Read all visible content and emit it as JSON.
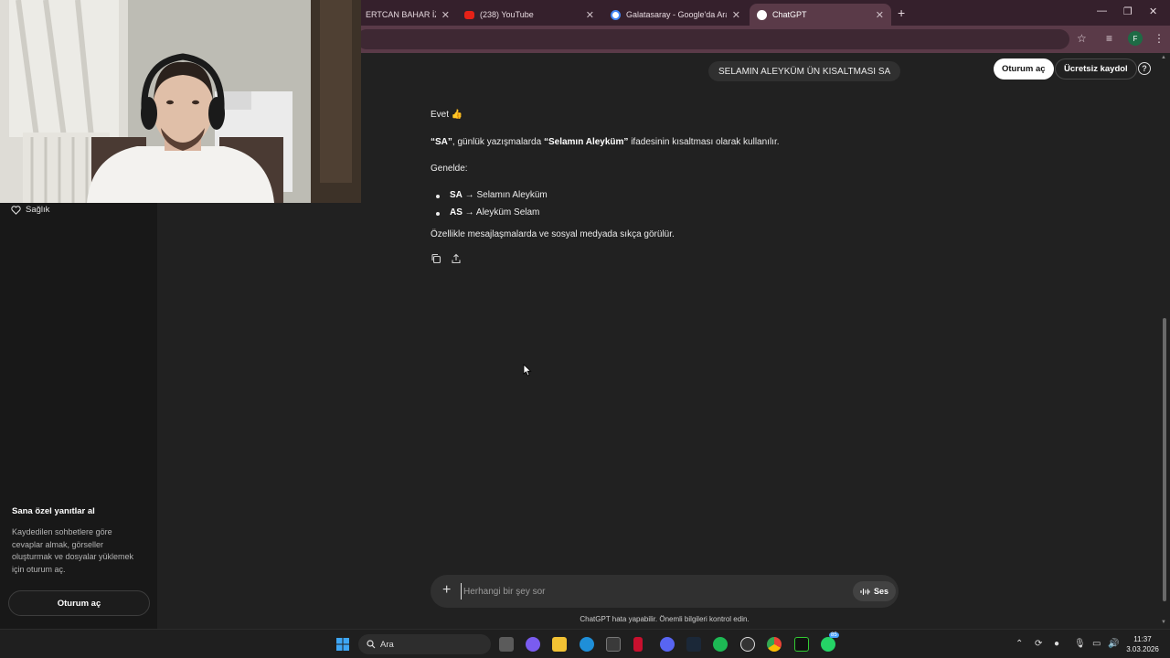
{
  "browser": {
    "tabs": [
      {
        "title": "ERTCAN BAHAR İZLİYOR",
        "active": false
      },
      {
        "title": "(238) YouTube",
        "active": false
      },
      {
        "title": "Galatasaray - Google'da Ara",
        "active": false
      },
      {
        "title": "ChatGPT",
        "active": true
      }
    ],
    "new_tab": "+",
    "profile_initial": "F"
  },
  "sidebar": {
    "health_label": "Sağlık",
    "promo_title": "Sana özel yanıtlar al",
    "promo_text": "Kaydedilen sohbetlere göre cevaplar almak, görseller oluşturmak ve dosyalar yüklemek için oturum aç.",
    "login_label": "Oturum aç"
  },
  "header": {
    "login_label": "Oturum aç",
    "signup_label": "Ücretsiz kaydol",
    "help": "?"
  },
  "chat": {
    "user_message": "SELAMIN ALEYKÜM ÜN KISALTMASI SA",
    "answer": {
      "intro": "Evet 👍",
      "p1_term": "“SA”",
      "p1_mid": ", günlük yazışmalarda ",
      "p1_bold": "“Selamın Aleyküm”",
      "p1_end": " ifadesinin kısaltması olarak kullanılır.",
      "genelde": "Genelde:",
      "bullets": [
        {
          "term": "SA",
          "text": " → Selamın Aleyküm"
        },
        {
          "term": "AS",
          "text": " → Aleyküm Selam"
        }
      ],
      "closing": "Özellikle mesajlaşmalarda ve sosyal medyada sıkça görülür."
    }
  },
  "composer": {
    "placeholder": "Herhangi bir şey sor",
    "voice_label": "Ses",
    "disclaimer": "ChatGPT hata yapabilir. Önemli bilgileri kontrol edin."
  },
  "taskbar": {
    "search_label": "Ara",
    "time": "11:37",
    "date": "3.03.2026",
    "whatsapp_badge": "85"
  }
}
